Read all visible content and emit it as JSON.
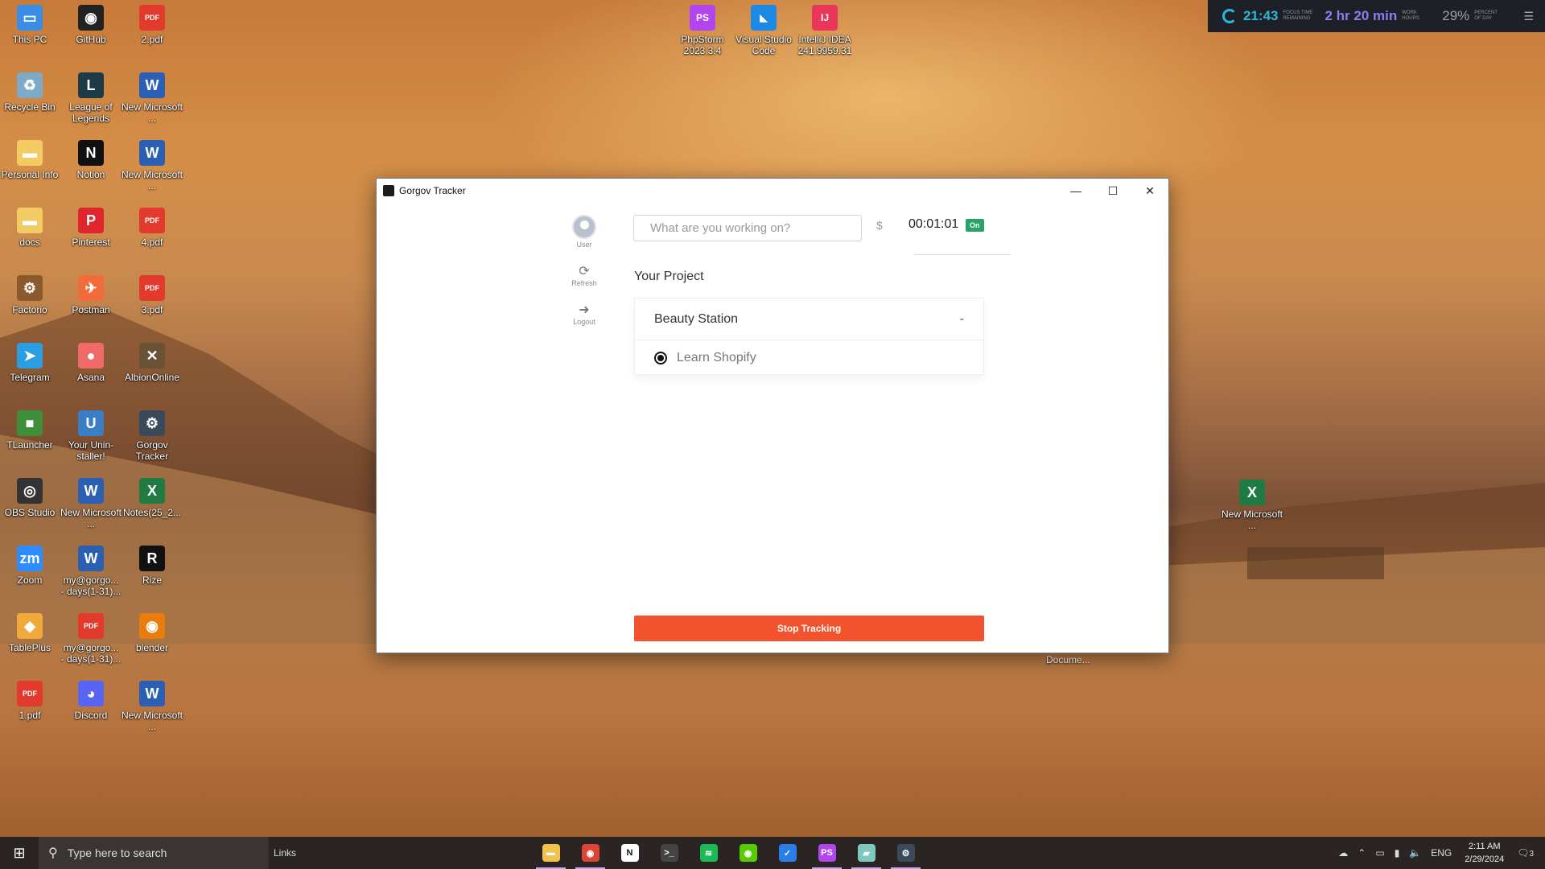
{
  "desktop": {
    "icons_left": [
      {
        "label": "This PC",
        "color": "#3a8ee6",
        "glyph": "▭"
      },
      {
        "label": "GitHub",
        "color": "#222222",
        "glyph": "◉"
      },
      {
        "label": "2.pdf",
        "color": "#e23b2e",
        "glyph": "PDF"
      },
      {
        "label": "Recycle Bin",
        "color": "#7fa9c8",
        "glyph": "♻"
      },
      {
        "label": "League of Legends",
        "color": "#1d3b47",
        "glyph": "L"
      },
      {
        "label": "New Microsoft ...",
        "color": "#2b5fb4",
        "glyph": "W"
      },
      {
        "label": "Personal Info",
        "color": "#f2cc63",
        "glyph": "▬"
      },
      {
        "label": "Notion",
        "color": "#111111",
        "glyph": "N"
      },
      {
        "label": "New Microsoft ...",
        "color": "#2b5fb4",
        "glyph": "W"
      },
      {
        "label": "docs",
        "color": "#f2cc63",
        "glyph": "▬"
      },
      {
        "label": "Pinterest",
        "color": "#e0252f",
        "glyph": "P"
      },
      {
        "label": "4.pdf",
        "color": "#e23b2e",
        "glyph": "PDF"
      },
      {
        "label": "Factorio",
        "color": "#8a5a2c",
        "glyph": "⚙"
      },
      {
        "label": "Postman",
        "color": "#f26b3a",
        "glyph": "✈"
      },
      {
        "label": "3.pdf",
        "color": "#e23b2e",
        "glyph": "PDF"
      },
      {
        "label": "Telegram",
        "color": "#2a9ee0",
        "glyph": "➤"
      },
      {
        "label": "Asana",
        "color": "#f06a6a",
        "glyph": "●"
      },
      {
        "label": "AlbionOnline",
        "color": "#6b5236",
        "glyph": "✕"
      },
      {
        "label": "TLauncher",
        "color": "#3f8f3a",
        "glyph": "■"
      },
      {
        "label": "Your Unin-staller!",
        "color": "#3a7ec8",
        "glyph": "U"
      },
      {
        "label": "Gorgov Tracker",
        "color": "#3a4a5a",
        "glyph": "⚙"
      },
      {
        "label": "OBS Studio",
        "color": "#333333",
        "glyph": "◎"
      },
      {
        "label": "New Microsoft ...",
        "color": "#2b5fb4",
        "glyph": "W"
      },
      {
        "label": "Notes(25_2...",
        "color": "#1f7a44",
        "glyph": "X"
      },
      {
        "label": "Zoom",
        "color": "#2d8cff",
        "glyph": "zm"
      },
      {
        "label": "my@gorgo... - days(1-31)...",
        "color": "#2b5fb4",
        "glyph": "W"
      },
      {
        "label": "Rize",
        "color": "#111111",
        "glyph": "R"
      },
      {
        "label": "TablePlus",
        "color": "#f2a93b",
        "glyph": "◆"
      },
      {
        "label": "my@gorgo... - days(1-31)...",
        "color": "#e23b2e",
        "glyph": "PDF"
      },
      {
        "label": "blender",
        "color": "#e87d0d",
        "glyph": "◉"
      },
      {
        "label": "1.pdf",
        "color": "#e23b2e",
        "glyph": "PDF"
      },
      {
        "label": "Discord",
        "color": "#5865f2",
        "glyph": "◕"
      },
      {
        "label": "New Microsoft ...",
        "color": "#2b5fb4",
        "glyph": "W"
      }
    ],
    "icons_top": [
      {
        "label": "PhpStorm 2023.3.4",
        "color": "#b345f1",
        "glyph": "PS"
      },
      {
        "label": "Visual Studio Code",
        "color": "#1e88e5",
        "glyph": "◣"
      },
      {
        "label": "IntelliJ IDEA 241.9959.31",
        "color": "#e8375a",
        "glyph": "IJ"
      }
    ],
    "icon_right": {
      "label": "New Microsoft ...",
      "color": "#1f7a44",
      "glyph": "X"
    },
    "behind_window_label": "Docume..."
  },
  "widget": {
    "focus_time": "21:43",
    "focus_caption": "FOCUS TIME REMAINING",
    "work_hours": "2 hr 20 min",
    "work_caption": "WORK HOURS",
    "percent": "29%",
    "percent_caption": "PERCENT OF DAY"
  },
  "window": {
    "title": "Gorgov Tracker",
    "sidebar": {
      "user_label": "User",
      "refresh_label": "Refresh",
      "logout_label": "Logout"
    },
    "search_placeholder": "What are you working on?",
    "currency_symbol": "$",
    "timer": "00:01:01",
    "status_badge": "On",
    "project_heading": "Your Project",
    "project_name": "Beauty Station",
    "project_toggle": "-",
    "task_name": "Learn Shopify",
    "stop_button": "Stop Tracking"
  },
  "taskbar": {
    "search_placeholder": "Type here to search",
    "links_label": "Links",
    "apps": [
      {
        "name": "file-explorer",
        "color": "#f2c14e",
        "glyph": "▬",
        "active": true
      },
      {
        "name": "chrome",
        "color": "#db4437",
        "glyph": "◉",
        "active": true
      },
      {
        "name": "notion",
        "color": "#ffffff",
        "glyph": "N",
        "active": false
      },
      {
        "name": "terminal",
        "color": "#444444",
        "glyph": ">_",
        "active": false
      },
      {
        "name": "spotify",
        "color": "#1db954",
        "glyph": "≋",
        "active": false
      },
      {
        "name": "duolingo",
        "color": "#58cc02",
        "glyph": "◉",
        "active": false
      },
      {
        "name": "todo",
        "color": "#2b7de9",
        "glyph": "✓",
        "active": false
      },
      {
        "name": "phpstorm",
        "color": "#b345f1",
        "glyph": "PS",
        "active": true
      },
      {
        "name": "notes",
        "color": "#7fc8c0",
        "glyph": "▰",
        "active": true
      },
      {
        "name": "gorgov-tracker",
        "color": "#3a4a5a",
        "glyph": "⚙",
        "active": true
      }
    ],
    "tray": {
      "language": "ENG",
      "time": "2:11 AM",
      "date": "2/29/2024",
      "notifications": "3"
    }
  }
}
